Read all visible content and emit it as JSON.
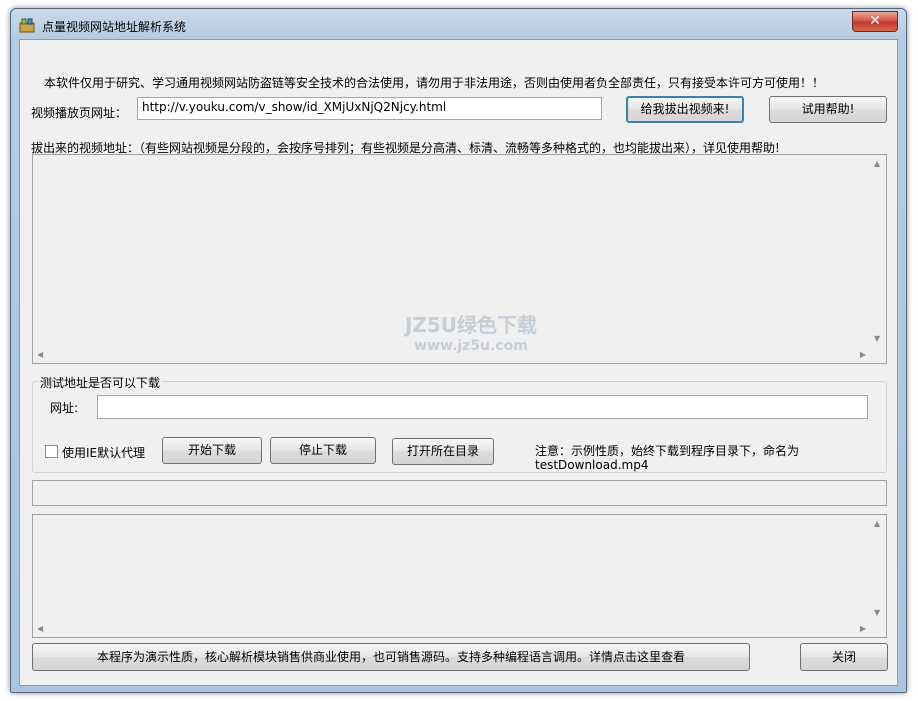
{
  "window": {
    "title": "点量视频网站地址解析系统",
    "close_glyph": "✕"
  },
  "disclaimer": "本软件仅用于研究、学习通用视频网站防盗链等安全技术的合法使用，请勿用于非法用途，否则由使用者负全部责任，只有接受本许可方可使用！！",
  "url_row": {
    "label": "视频播放页网址：",
    "value": "http://v.youku.com/v_show/id_XMjUxNjQ2Njcy.html",
    "extract_button": "给我拔出视频来!",
    "help_button": "试用帮助!"
  },
  "result_label": "拔出来的视频地址：（有些网站视频是分段的，会按序号排列；有些视频是分高清、标清、流畅等多种格式的，也均能拔出来），详见使用帮助!",
  "test_group": {
    "legend": "测试地址是否可以下载",
    "url_label": "网址:",
    "url_value": "",
    "proxy_checkbox_label": "使用IE默认代理",
    "proxy_checked": false,
    "start_button": "开始下载",
    "stop_button": "停止下载",
    "open_dir_button": "打开所在目录",
    "note_line1": "注意：示例性质，始终下载到程序目录下，命名为",
    "note_line2": "testDownload.mp4"
  },
  "watermark": {
    "line1": "JZ5U绿色下载",
    "line2": "www.jz5u.com"
  },
  "footer": {
    "info_button": "本程序为演示性质，核心解析模块销售供商业使用，也可销售源码。支持多种编程语言调用。详情点击这里查看",
    "close_button": "关闭"
  }
}
